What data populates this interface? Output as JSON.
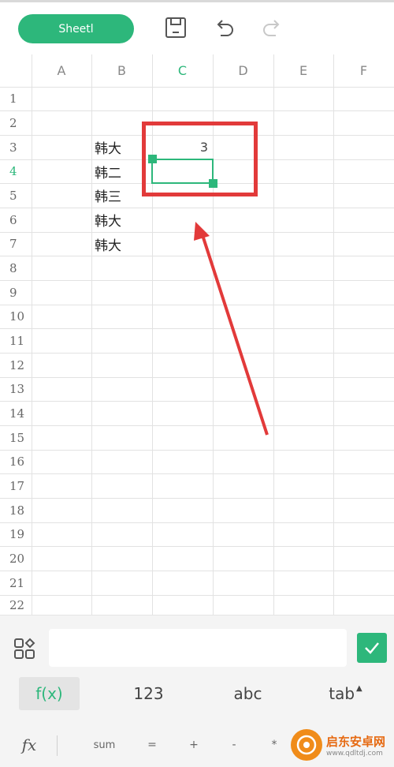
{
  "toolbar": {
    "sheet_tab_label": "Sheetl",
    "save_icon": "save-icon",
    "undo_icon": "undo-icon",
    "redo_icon": "redo-icon"
  },
  "grid": {
    "columns": [
      "A",
      "B",
      "C",
      "D",
      "E",
      "F"
    ],
    "active_column": "C",
    "rows": [
      "1",
      "2",
      "3",
      "4",
      "5",
      "6",
      "7",
      "8",
      "9",
      "10",
      "11",
      "12",
      "13",
      "14",
      "15",
      "16",
      "17",
      "18",
      "19",
      "20",
      "21",
      "22"
    ],
    "active_row": "4",
    "cells": {
      "B3": "韩大",
      "B4": "韩二",
      "B5": "韩三",
      "B6": "韩大",
      "B7": "韩大",
      "C3": "3"
    },
    "selected_cell": "C4"
  },
  "input_bar": {
    "value": "",
    "confirm_icon": "check-icon",
    "toggle_icon": "grid-icon"
  },
  "keyboard_tabs": {
    "fx": "f(x)",
    "numbers": "123",
    "letters": "abc",
    "tab": "tab"
  },
  "function_row": {
    "fx": "fx",
    "sum": "sum",
    "equals": "=",
    "plus": "+",
    "minus": "-",
    "star": "*"
  },
  "watermark": {
    "title": "启东安卓网",
    "url": "www.qdltdj.com"
  },
  "colors": {
    "accent": "#2db77b",
    "annotation": "#e23a3a"
  }
}
